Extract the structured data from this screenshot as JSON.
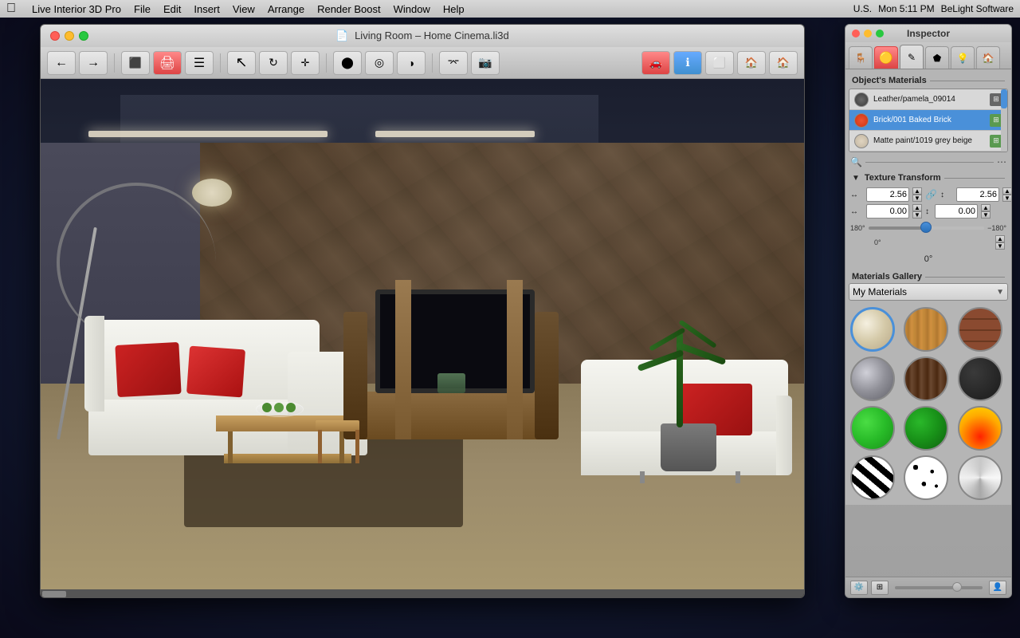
{
  "menubar": {
    "apple": "&#63743;",
    "items": [
      "Live Interior 3D Pro",
      "File",
      "Edit",
      "Insert",
      "View",
      "Arrange",
      "Render Boost",
      "Window",
      "Help"
    ],
    "right": {
      "time": "Mon 5:11 PM",
      "brand": "BeLight Software",
      "locale": "U.S."
    }
  },
  "main_window": {
    "title": "Living Room – Home Cinema.li3d",
    "toolbar": {
      "nav_back": "←",
      "nav_forward": "→"
    }
  },
  "inspector": {
    "title": "Inspector",
    "sections": {
      "materials_header": "Object's Materials",
      "texture_transform_header": "Texture Transform",
      "gallery_header": "Materials Gallery"
    },
    "materials": [
      {
        "name": "Leather/pamela_09014",
        "color": "#5a5a5a",
        "selected": false
      },
      {
        "name": "Brick/001 Baked Brick",
        "color": "#cc4422",
        "selected": true
      },
      {
        "name": "Matte paint/1019 grey beige",
        "color": "#d4c4b0",
        "selected": false
      }
    ],
    "texture_transform": {
      "scale_x": "2.56",
      "scale_y": "2.56",
      "offset_x": "0.00",
      "offset_y": "0.00",
      "angle": "0°",
      "label_neg": "180°",
      "label_zero": "0°",
      "label_pos": "−180°"
    },
    "gallery": {
      "dropdown_label": "My Materials",
      "materials": [
        {
          "name": "cream-plaster",
          "class": "mat-cream",
          "selected": true
        },
        {
          "name": "light-wood",
          "class": "mat-wood-light",
          "selected": false
        },
        {
          "name": "brick-texture",
          "class": "mat-brick",
          "selected": false
        },
        {
          "name": "metal-plate",
          "class": "mat-metal",
          "selected": false
        },
        {
          "name": "dark-wood",
          "class": "mat-dark-wood",
          "selected": false
        },
        {
          "name": "dark-material",
          "class": "mat-dark",
          "selected": false
        },
        {
          "name": "bright-green",
          "class": "mat-green-bright",
          "selected": false
        },
        {
          "name": "dark-green",
          "class": "mat-green-dark",
          "selected": false
        },
        {
          "name": "fire-material",
          "class": "mat-fire",
          "selected": false
        },
        {
          "name": "zebra-pattern",
          "class": "mat-zebra",
          "selected": false
        },
        {
          "name": "spots-pattern",
          "class": "mat-spots",
          "selected": false
        },
        {
          "name": "chrome-material",
          "class": "mat-chrome",
          "selected": false
        }
      ]
    },
    "tabs": [
      "🪑",
      "🟡",
      "✏️",
      "🪨",
      "💡",
      "🏠"
    ]
  }
}
